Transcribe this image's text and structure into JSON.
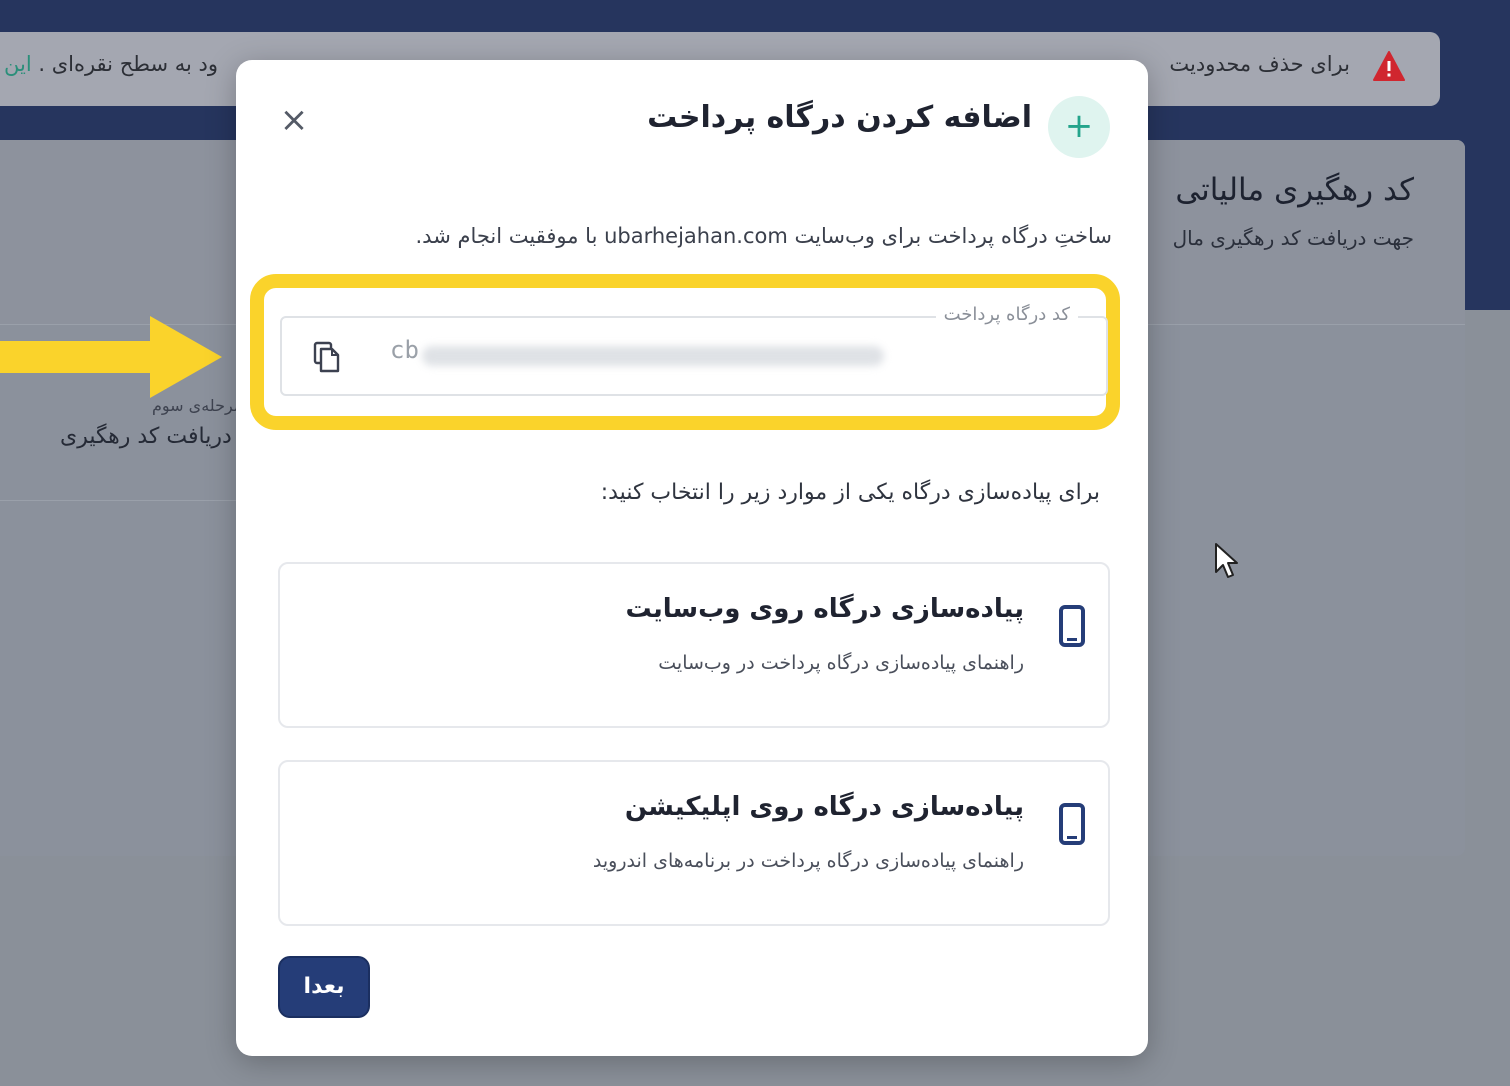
{
  "background": {
    "alert": {
      "text_right": "برای حذف محدودیت",
      "text_left": "ود به سطح نقره‌ای . ",
      "link": "این"
    },
    "card": {
      "title": "کد رهگیری مالیاتی",
      "subtitle": "جهت دریافت کد رهگیری مال",
      "step_label": "مرحله‌ی سوم",
      "step_title": "دریافت کد رهگیری"
    }
  },
  "modal": {
    "title": "اضافه کردن درگاه پرداخت",
    "add_icon": "+",
    "close_icon": "×",
    "success_message": "ساختِ درگاه پرداخت برای وب‌سایت ubarhejahan.com با موفقیت انجام شد.",
    "code_field": {
      "label": "کد درگاه پرداخت",
      "value_visible": "cb"
    },
    "instruction": "برای پیاده‌سازی درگاه یکی از موارد زیر را انتخاب کنید:",
    "options": [
      {
        "title": "پیاده‌سازی درگاه روی وب‌سایت",
        "description": "راهنمای پیاده‌سازی درگاه پرداخت در وب‌سایت",
        "icon": "phone-icon"
      },
      {
        "title": "پیاده‌سازی درگاه روی اپلیکیشن",
        "description": "راهنمای پیاده‌سازی درگاه پرداخت در برنامه‌های اندروید",
        "icon": "phone-icon"
      }
    ],
    "next_button": "بعدا"
  },
  "colors": {
    "primary": "#253d78",
    "accent": "#23a48b",
    "highlight": "#fad32b",
    "warning": "#d0262f"
  }
}
